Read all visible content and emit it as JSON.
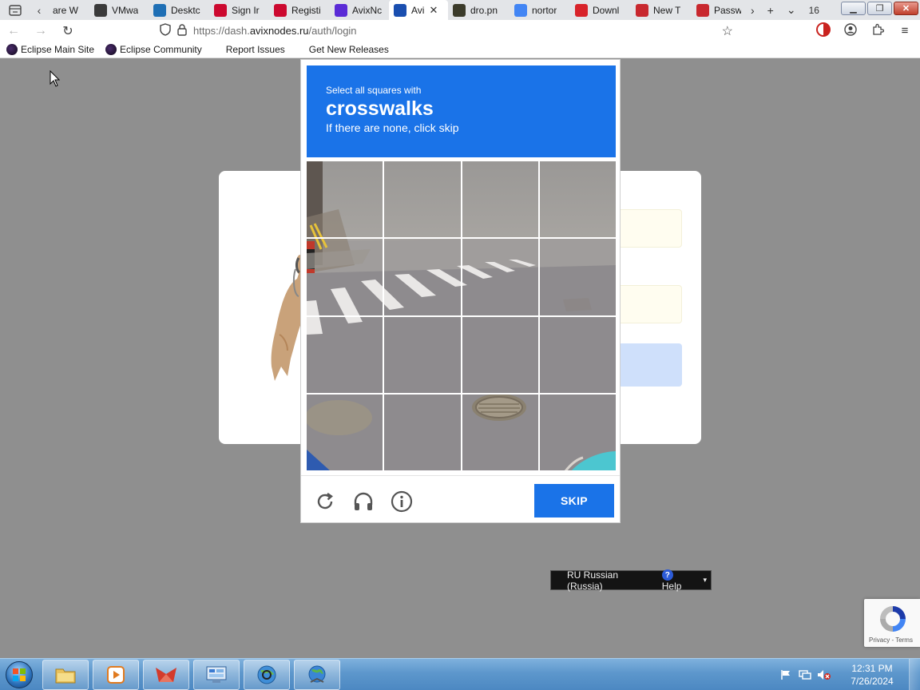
{
  "browser": {
    "tabs": [
      {
        "label": "are W",
        "icon": "vmware-icon",
        "color": "#4a4a4a"
      },
      {
        "label": "VMwa",
        "icon": "vmware-doc-icon",
        "color": "#3a3a3a"
      },
      {
        "label": "Desktc",
        "icon": "vmw-icon",
        "color": "#1e6fb5"
      },
      {
        "label": "Sign Ir",
        "icon": "broadcom-icon",
        "color": "#cc092f"
      },
      {
        "label": "Registi",
        "icon": "broadcom-icon",
        "color": "#cc092f"
      },
      {
        "label": "AvixNc",
        "icon": "avix-icon",
        "color": "#5a2bd6"
      },
      {
        "label": "Avi",
        "icon": "avix-active-icon",
        "color": "#1a4fb0",
        "active": true
      },
      {
        "label": "dro.pn",
        "icon": "image-icon",
        "color": "#3b3b2a"
      },
      {
        "label": "nortor",
        "icon": "google-icon",
        "color": "#4285f4"
      },
      {
        "label": "Downl",
        "icon": "download-red-icon",
        "color": "#d8232a"
      },
      {
        "label": "New T",
        "icon": "fox-red-icon",
        "color": "#c8282e"
      },
      {
        "label": "Passw",
        "icon": "fox-red-icon",
        "color": "#c8282e"
      }
    ],
    "tab_count": "16",
    "url_prefix": "https://dash.",
    "url_domain": "avixnodes.ru",
    "url_path": "/auth/login",
    "bookmarks": [
      {
        "label": "Eclipse Main Site",
        "icon": true
      },
      {
        "label": "Eclipse Community",
        "icon": true
      },
      {
        "label": "Report Issues",
        "icon": false
      },
      {
        "label": "Get New Releases",
        "icon": false
      }
    ]
  },
  "captcha": {
    "line1": "Select all squares with",
    "keyword": "crosswalks",
    "line3": "If there are none, click skip",
    "skip_label": "SKIP",
    "header_color": "#1a73e8"
  },
  "langbar": {
    "language": "RU Russian (Russia)",
    "help": "Help"
  },
  "recaptcha": {
    "terms": "Privacy - Terms"
  },
  "taskbar": {
    "time": "12:31 PM",
    "date": "7/26/2024"
  }
}
